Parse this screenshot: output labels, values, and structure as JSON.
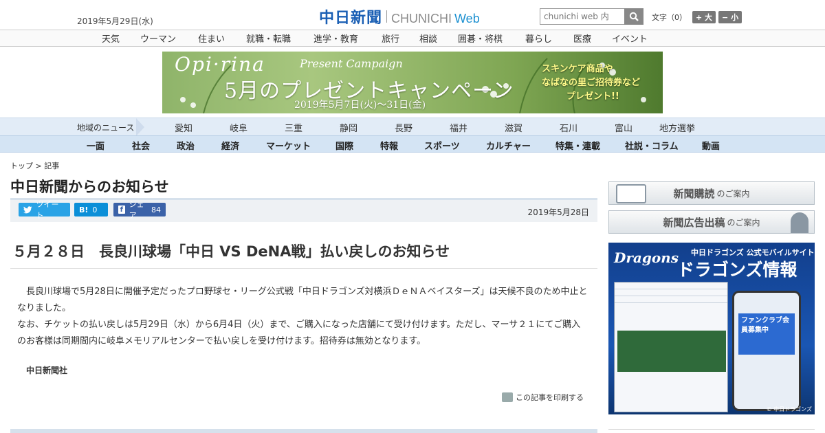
{
  "header": {
    "date": "2019年5月29日(水)",
    "logo_jp": "中日新聞",
    "logo_en": "CHUNICHI",
    "logo_web": "Web",
    "search_placeholder": "chunichi web 内",
    "font_label": "文字（0）",
    "font_large": "+ 大",
    "font_small": "− 小"
  },
  "genre_nav": [
    "天気",
    "ウーマン",
    "住まい",
    "就職・転職",
    "進学・教育",
    "旅行",
    "相談",
    "囲碁・将棋",
    "暮らし",
    "医療",
    "イベント"
  ],
  "banner": {
    "brand": "Opi·rina",
    "sub": "Present Campaign",
    "main": "5月のプレゼントキャンペーン",
    "date": "2019年5月7日(火)〜31日(金)",
    "right_lines": [
      "スキンケア商品や",
      "なばなの里ご招待券など",
      "プレゼント!!"
    ]
  },
  "region_nav": {
    "label": "地域のニュース",
    "items": [
      "愛知",
      "岐阜",
      "三重",
      "静岡",
      "長野",
      "福井",
      "滋賀",
      "石川",
      "富山",
      "地方選挙"
    ]
  },
  "category_nav": [
    "一面",
    "社会",
    "政治",
    "経済",
    "マーケット",
    "国際",
    "特報",
    "スポーツ",
    "カルチャー",
    "特集・連載",
    "社説・コラム",
    "動画"
  ],
  "breadcrumb": {
    "top": "トップ",
    "sep": ">",
    "current": "記事"
  },
  "page_title": "中日新聞からのお知らせ",
  "share": {
    "tweet": "ツイート",
    "hatena_count": "0",
    "fb_label": "シェア",
    "fb_count": "84",
    "date": "2019年5月28日"
  },
  "article": {
    "headline": "５月２８日　長良川球場「中日 VS DeNA戦」払い戻しのお知らせ",
    "para1": "　長良川球場で5月28日に開催予定だったプロ野球セ・リーグ公式戦「中日ドラゴンズ対横浜ＤｅＮＡベイスターズ」は天候不良のため中止となりました。",
    "para2": "なお、チケットの払い戻しは5月29日（水）から6月4日（火）まで、ご購入になった店舗にて受け付けます。ただし、マーサ２１にてご購入のお客様は同期間内に岐阜メモリアルセンターで払い戻しを受け付けます。招待券は無効となります。",
    "org": "中日新聞社",
    "print": "この記事を印刷する"
  },
  "sidebar": {
    "subscribe_main": "新聞購読",
    "subscribe_sub": "のご案内",
    "ad_main": "新聞広告出稿",
    "ad_sub": "のご案内",
    "dragons_logo": "Dragons",
    "dragons_sub": "中日ドラゴンズ 公式モバイルサイト",
    "dragons_big": "ドラゴンズ情報",
    "dragons_phone": "ファンクラブ会員募集中",
    "dragons_copy": "© 中日ドラゴンズ"
  },
  "colors": {
    "brand_blue": "#1a5fb4",
    "twitter": "#2aa3e6",
    "hatena": "#0b8fd8",
    "facebook": "#3b62a8",
    "region_bg": "#e2ecf7",
    "category_bg": "#d4e4f4"
  }
}
